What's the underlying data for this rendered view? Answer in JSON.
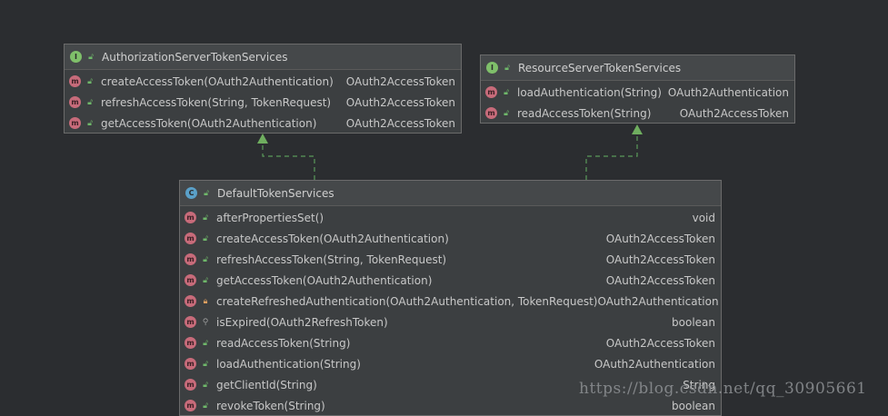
{
  "icons": {
    "interface_badge": "I",
    "class_badge": "C",
    "method_badge": "m",
    "public_icon": "unlock-icon",
    "protected_icon": "lock-icon",
    "package_icon": "key-icon"
  },
  "colors": {
    "background": "#2b2d30",
    "box_background": "#3c3f41",
    "connector": "#5a9a5a"
  },
  "auth_service": {
    "title": "AuthorizationServerTokenServices",
    "methods": [
      {
        "name": "createAccessToken(OAuth2Authentication)",
        "type": "OAuth2AccessToken"
      },
      {
        "name": "refreshAccessToken(String, TokenRequest)",
        "type": "OAuth2AccessToken"
      },
      {
        "name": "getAccessToken(OAuth2Authentication)",
        "type": "OAuth2AccessToken"
      }
    ]
  },
  "resource_service": {
    "title": "ResourceServerTokenServices",
    "methods": [
      {
        "name": "loadAuthentication(String)",
        "type": "OAuth2Authentication"
      },
      {
        "name": "readAccessToken(String)",
        "type": "OAuth2AccessToken"
      }
    ]
  },
  "default_service": {
    "title": "DefaultTokenServices",
    "methods": [
      {
        "name": "afterPropertiesSet()",
        "type": "void",
        "visibility": "public"
      },
      {
        "name": "createAccessToken(OAuth2Authentication)",
        "type": "OAuth2AccessToken",
        "visibility": "public"
      },
      {
        "name": "refreshAccessToken(String, TokenRequest)",
        "type": "OAuth2AccessToken",
        "visibility": "public"
      },
      {
        "name": "getAccessToken(OAuth2Authentication)",
        "type": "OAuth2AccessToken",
        "visibility": "public"
      },
      {
        "name": "createRefreshedAuthentication(OAuth2Authentication, TokenRequest)",
        "type": "OAuth2Authentication",
        "visibility": "protected"
      },
      {
        "name": "isExpired(OAuth2RefreshToken)",
        "type": "boolean",
        "visibility": "package"
      },
      {
        "name": "readAccessToken(String)",
        "type": "OAuth2AccessToken",
        "visibility": "public"
      },
      {
        "name": "loadAuthentication(String)",
        "type": "OAuth2Authentication",
        "visibility": "public"
      },
      {
        "name": "getClientId(String)",
        "type": "String",
        "visibility": "public"
      },
      {
        "name": "revokeToken(String)",
        "type": "boolean",
        "visibility": "public"
      }
    ]
  },
  "watermark": "https://blog.csdn.net/qq_30905661"
}
